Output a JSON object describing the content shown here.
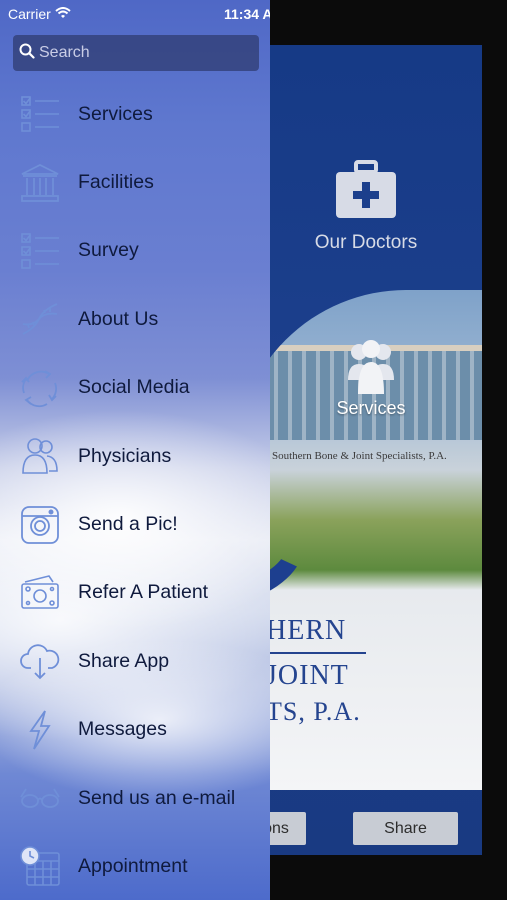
{
  "status_bar": {
    "carrier": "Carrier",
    "time": "11:34 A"
  },
  "search": {
    "placeholder": "Search"
  },
  "menu": {
    "items": [
      {
        "label": "Services",
        "icon": "checklist-icon"
      },
      {
        "label": "Facilities",
        "icon": "building-icon"
      },
      {
        "label": "Survey",
        "icon": "checklist-icon"
      },
      {
        "label": "About Us",
        "icon": "dna-icon"
      },
      {
        "label": "Social Media",
        "icon": "refresh-icon"
      },
      {
        "label": "Physicians",
        "icon": "people-icon"
      },
      {
        "label": "Send a Pic!",
        "icon": "camera-icon"
      },
      {
        "label": "Refer A Patient",
        "icon": "money-icon"
      },
      {
        "label": "Share App",
        "icon": "cloud-download-icon"
      },
      {
        "label": "Messages",
        "icon": "lightning-icon"
      },
      {
        "label": "Send us an e-mail",
        "icon": "glasses-icon"
      },
      {
        "label": "Appointment",
        "icon": "calendar-clock-icon"
      }
    ]
  },
  "app": {
    "doctors_label": "Our Doctors",
    "services_label": "Services",
    "sign_text": "Southern Bone & Joint Specialists, P.A.",
    "logo_line1": "HERN",
    "logo_line2": "JOINT",
    "logo_line3": "TS, P.A.",
    "button1": "ons",
    "button2": "Share"
  },
  "colors": {
    "drawer_top": "#4f68c6",
    "app_panel": "#1c3f8c",
    "icon_stroke": "#6f8fd8"
  }
}
